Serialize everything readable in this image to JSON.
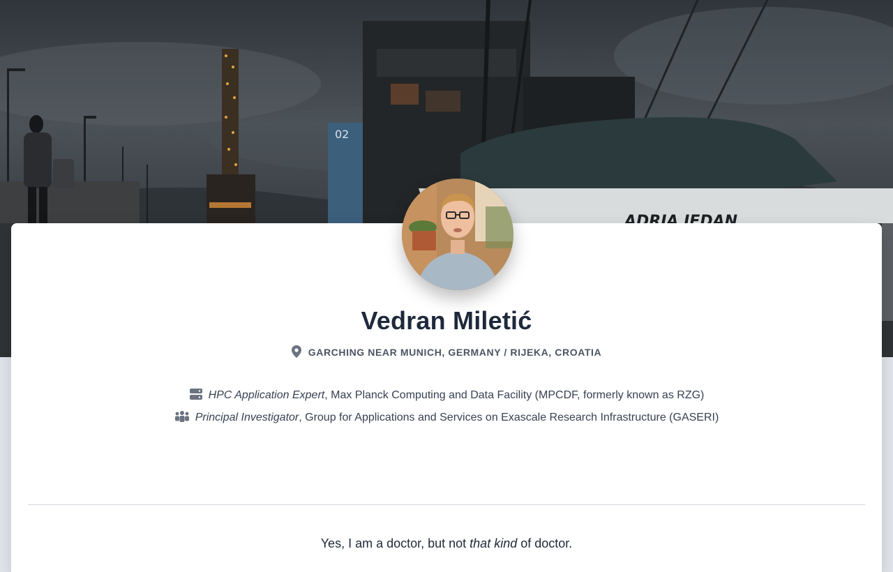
{
  "profile": {
    "name": "Vedran Miletić",
    "location": "GARCHING NEAR MUNICH, GERMANY / RIJEKA, CROATIA",
    "roles": [
      {
        "icon": "server-icon",
        "title": "HPC Application Expert",
        "org": ", Max Planck Computing and Data Facility (MPCDF, formerly known as RZG)"
      },
      {
        "icon": "users-icon",
        "title": "Principal Investigator",
        "org": ", Group for Applications and Services on Exascale Research Infrastructure (GASERI)"
      }
    ],
    "tagline": {
      "before": "Yes, I am a doctor, but not ",
      "emphasis": "that kind",
      "after": " of doctor."
    }
  },
  "hero": {
    "boat_label": "ADRIA JEDAN",
    "post_number": "02"
  },
  "colors": {
    "page_bg": "#e2e6ec",
    "card_bg": "#ffffff",
    "name": "#1e293b",
    "muted": "#4b5563",
    "icon": "#6b7280"
  }
}
